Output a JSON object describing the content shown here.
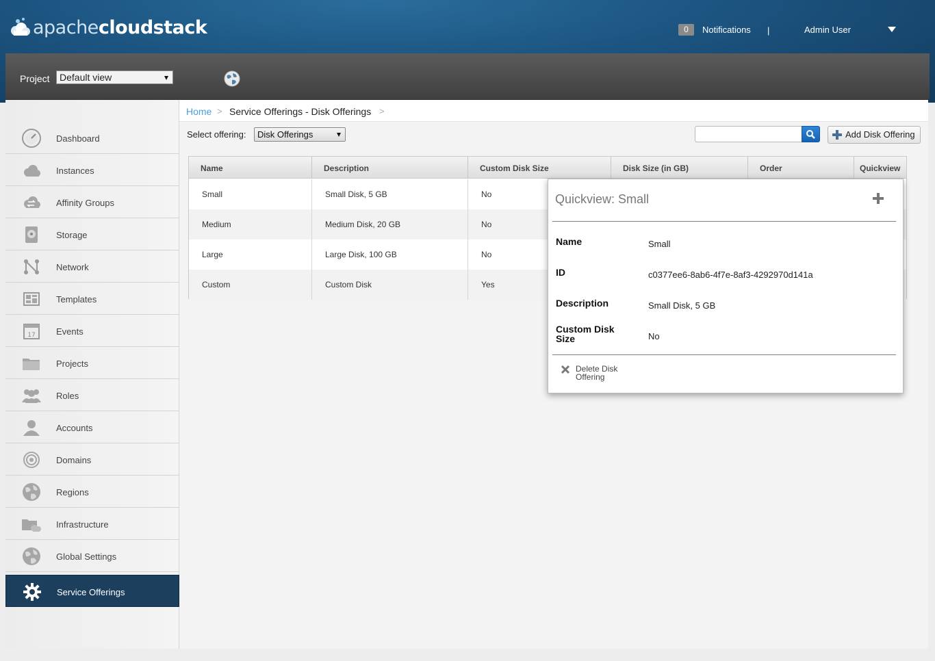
{
  "header": {
    "logo_prefix": "apache",
    "logo_bold": "cloud",
    "logo_suffix": "stack",
    "notification_count": "0",
    "notifications_label": "Notifications",
    "separator": "|",
    "user": "Admin User"
  },
  "projectbar": {
    "label": "Project",
    "selected": "Default view"
  },
  "sidebar": {
    "items": [
      {
        "label": "Dashboard",
        "icon": "dashboard-icon"
      },
      {
        "label": "Instances",
        "icon": "cloud-icon"
      },
      {
        "label": "Affinity Groups",
        "icon": "affinity-icon"
      },
      {
        "label": "Storage",
        "icon": "disk-icon"
      },
      {
        "label": "Network",
        "icon": "network-icon"
      },
      {
        "label": "Templates",
        "icon": "templates-icon"
      },
      {
        "label": "Events",
        "icon": "calendar-icon"
      },
      {
        "label": "Projects",
        "icon": "folder-icon"
      },
      {
        "label": "Roles",
        "icon": "roles-icon"
      },
      {
        "label": "Accounts",
        "icon": "user-icon"
      },
      {
        "label": "Domains",
        "icon": "domains-icon"
      },
      {
        "label": "Regions",
        "icon": "globe-icon"
      },
      {
        "label": "Infrastructure",
        "icon": "infrastructure-icon"
      },
      {
        "label": "Global Settings",
        "icon": "settings-globe-icon"
      },
      {
        "label": "Service Offerings",
        "icon": "gear-icon",
        "active": true
      }
    ],
    "calendar_day": "17"
  },
  "breadcrumb": {
    "home": "Home",
    "sep": ">",
    "current": "Service Offerings - Disk Offerings"
  },
  "toolbar": {
    "select_label": "Select offering:",
    "select_value": "Disk Offerings",
    "add_label": "Add Disk Offering"
  },
  "table": {
    "columns": [
      "Name",
      "Description",
      "Custom Disk Size",
      "Disk Size (in GB)",
      "Order",
      "Quickview"
    ],
    "rows": [
      [
        "Small",
        "Small Disk, 5 GB",
        "No"
      ],
      [
        "Medium",
        "Medium Disk, 20 GB",
        "No"
      ],
      [
        "Large",
        "Large Disk, 100 GB",
        "No"
      ],
      [
        "Custom",
        "Custom Disk",
        "Yes"
      ]
    ]
  },
  "quickview": {
    "title": "Quickview: Small",
    "fields": [
      {
        "key": "Name",
        "value": "Small"
      },
      {
        "key": "ID",
        "value": "c0377ee6-8ab6-4f7e-8af3-4292970d141a"
      },
      {
        "key": "Description",
        "value": "Small Disk, 5 GB"
      },
      {
        "key": "Custom Disk Size",
        "value": "No"
      }
    ],
    "action": "Delete Disk Offering"
  },
  "colors": {
    "header_blue": "#1c5480",
    "active_nav": "#1c3f5e",
    "link": "#4a9fd6",
    "search_button": "#1662b4"
  }
}
